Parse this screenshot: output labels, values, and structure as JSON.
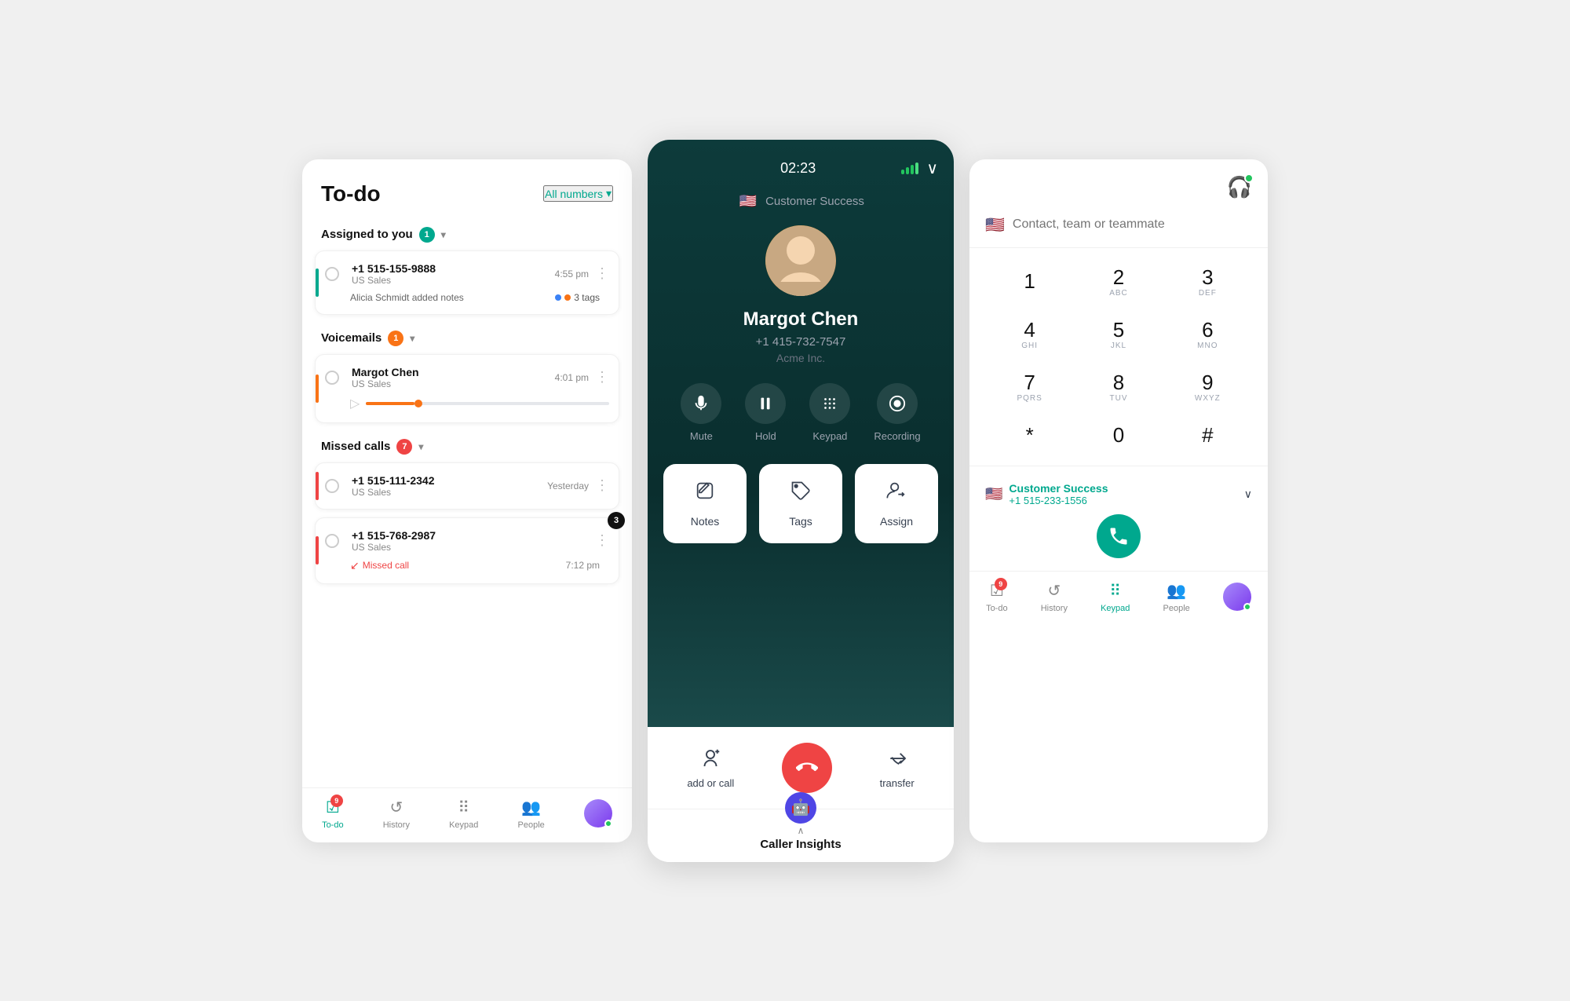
{
  "todo": {
    "title": "To-do",
    "filter_label": "All numbers",
    "sections": {
      "assigned": {
        "label": "Assigned to you",
        "count": "1",
        "items": [
          {
            "number": "+1 515-155-9888",
            "team": "US Sales",
            "time": "4:55 pm",
            "indicator": "green",
            "note": "Alicia Schmidt added notes",
            "tags_count": "3 tags"
          }
        ]
      },
      "voicemails": {
        "label": "Voicemails",
        "count": "1",
        "items": [
          {
            "name": "Margot Chen",
            "team": "US Sales",
            "time": "4:01 pm",
            "indicator": "orange"
          }
        ]
      },
      "missed": {
        "label": "Missed calls",
        "count": "7",
        "items": [
          {
            "number": "+1 515-111-2342",
            "team": "US Sales",
            "time": "Yesterday",
            "indicator": "red"
          },
          {
            "number": "+1 515-768-2987",
            "team": "US Sales",
            "time": "7:12 pm",
            "indicator": "red",
            "badge": "3",
            "missed_label": "Missed call"
          }
        ]
      }
    },
    "nav": {
      "todo": "To-do",
      "history": "History",
      "keypad": "Keypad",
      "people": "People",
      "todo_badge": "9"
    }
  },
  "active_call": {
    "timer": "02:23",
    "team": "Customer Success",
    "caller_name": "Margot Chen",
    "caller_number": "+1 415-732-7547",
    "caller_company": "Acme Inc.",
    "controls": {
      "mute": "Mute",
      "hold": "Hold",
      "keypad": "Keypad",
      "recording": "Recording"
    },
    "actions": {
      "notes": "Notes",
      "tags": "Tags",
      "assign": "Assign"
    },
    "bottom_actions": {
      "add_or_call": "add or call",
      "transfer": "transfer"
    },
    "insights_label": "Caller Insights"
  },
  "dialer": {
    "search_placeholder": "Contact, team or teammate",
    "keys": [
      {
        "num": "1",
        "alpha": ""
      },
      {
        "num": "2",
        "alpha": "ABC"
      },
      {
        "num": "3",
        "alpha": "DEF"
      },
      {
        "num": "4",
        "alpha": "GHI"
      },
      {
        "num": "5",
        "alpha": "JKL"
      },
      {
        "num": "6",
        "alpha": "MNO"
      },
      {
        "num": "7",
        "alpha": "PQRS"
      },
      {
        "num": "8",
        "alpha": "TUV"
      },
      {
        "num": "9",
        "alpha": "WXYZ"
      },
      {
        "num": "*",
        "alpha": ""
      },
      {
        "num": "0",
        "alpha": ""
      },
      {
        "num": "#",
        "alpha": ""
      }
    ],
    "active_team": "Customer Success",
    "active_number": "+1 515-233-1556",
    "nav": {
      "todo": "To-do",
      "history": "History",
      "keypad": "Keypad",
      "people": "People",
      "todo_badge": "9"
    }
  }
}
